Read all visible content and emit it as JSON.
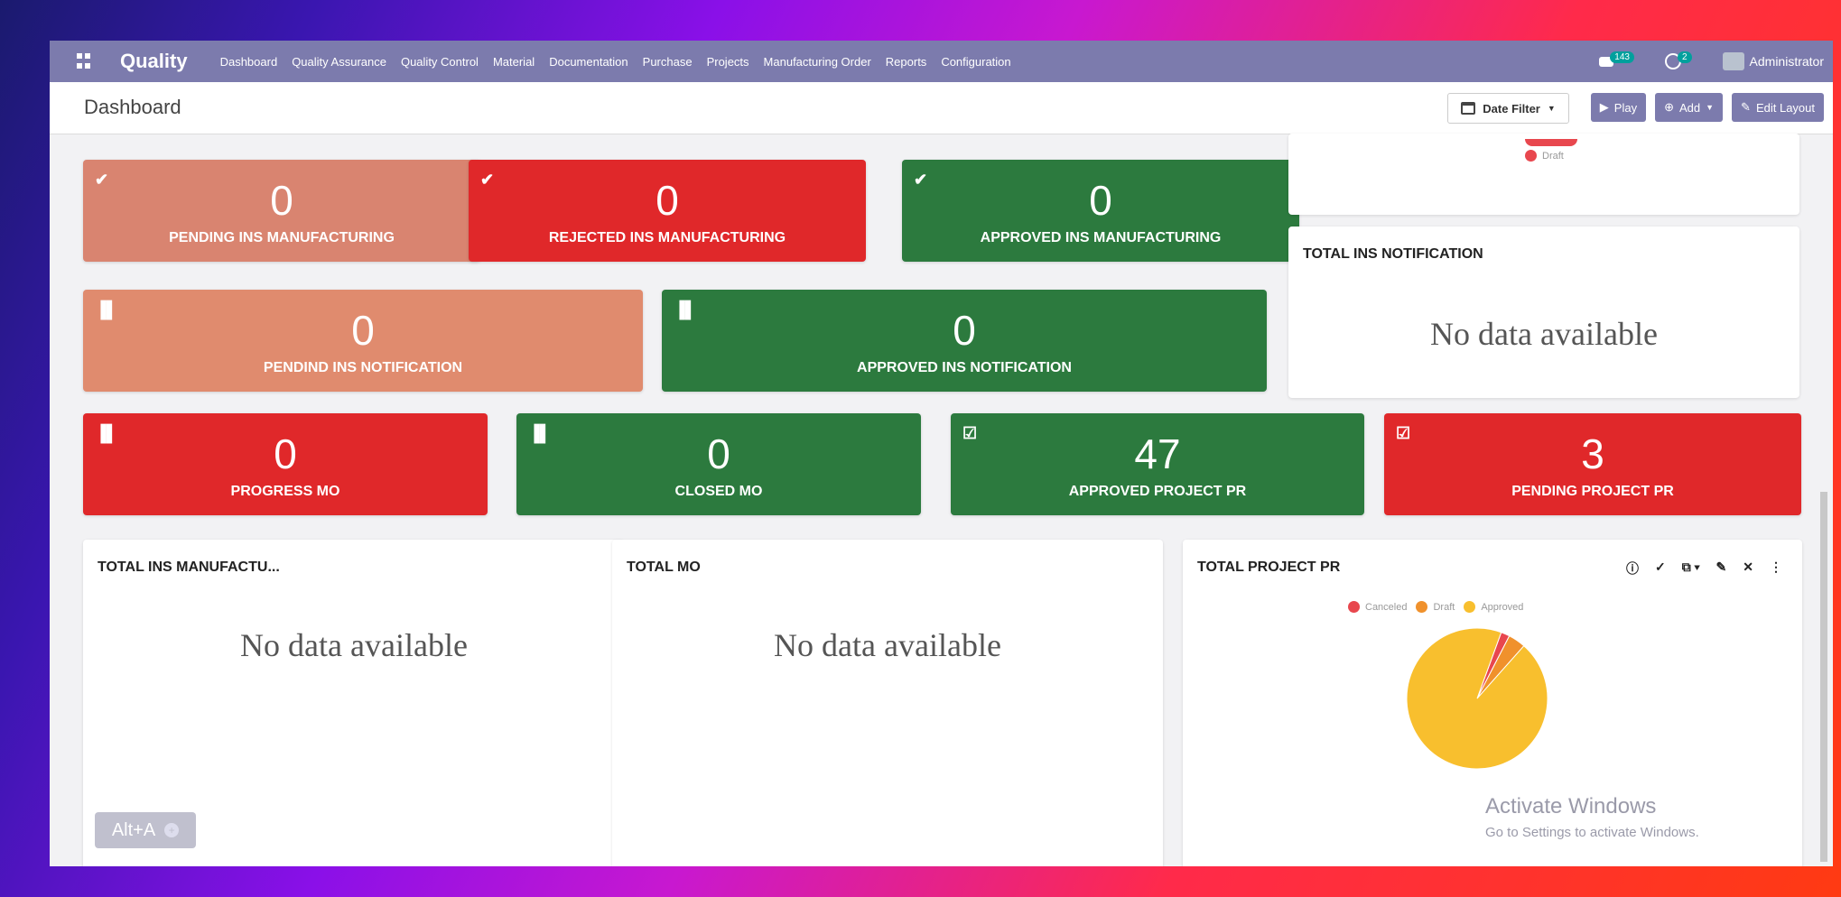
{
  "navbar": {
    "brand": "Quality",
    "menu": [
      "Dashboard",
      "Quality Assurance",
      "Quality Control",
      "Material",
      "Documentation",
      "Purchase",
      "Projects",
      "Manufacturing Order",
      "Reports",
      "Configuration"
    ],
    "chat_count": "143",
    "activity_count": "2",
    "user": "Administrator"
  },
  "control_panel": {
    "title": "Dashboard",
    "date_filter": "Date Filter",
    "play": "Play",
    "add": "Add",
    "edit_layout": "Edit Layout"
  },
  "tiles": [
    {
      "id": "pending-ins-manufacturing",
      "value": "0",
      "label": "PENDING INS MANUFACTURING",
      "icon": "check-icon",
      "color": "#d98470"
    },
    {
      "id": "rejected-ins-manufacturing",
      "value": "0",
      "label": "REJECTED INS MANUFACTURING",
      "icon": "check-icon",
      "color": "#e0282a"
    },
    {
      "id": "approved-ins-manufacturing",
      "value": "0",
      "label": "APPROVED INS MANUFACTURING",
      "icon": "check-icon",
      "color": "#2c7a3e"
    },
    {
      "id": "pendind-ins-notification",
      "value": "0",
      "label": "PENDIND INS NOTIFICATION",
      "icon": "bar-chart-icon",
      "color": "#e08b6e"
    },
    {
      "id": "approved-ins-notification",
      "value": "0",
      "label": "APPROVED INS NOTIFICATION",
      "icon": "bar-chart-icon",
      "color": "#2c7a3e"
    },
    {
      "id": "progress-mo",
      "value": "0",
      "label": "PROGRESS MO",
      "icon": "bar-chart-icon",
      "color": "#e0282a"
    },
    {
      "id": "closed-mo",
      "value": "0",
      "label": "CLOSED MO",
      "icon": "bar-chart-icon",
      "color": "#2c7a3e"
    },
    {
      "id": "approved-project-pr",
      "value": "47",
      "label": "APPROVED PROJECT PR",
      "icon": "checkbox-icon",
      "color": "#2c7a3e"
    },
    {
      "id": "pending-project-pr",
      "value": "3",
      "label": "PENDING PROJECT PR",
      "icon": "checkbox-icon",
      "color": "#e0282a"
    }
  ],
  "cards": {
    "top_partial": {
      "legend": "Draft"
    },
    "total_ins_notification": {
      "title": "TOTAL INS NOTIFICATION",
      "empty": "No data available"
    },
    "total_ins_manufactu": {
      "title": "TOTAL INS MANUFACTU...",
      "empty": "No data available"
    },
    "total_mo": {
      "title": "TOTAL MO",
      "empty": "No data available"
    },
    "total_project_pr": {
      "title": "TOTAL PROJECT PR"
    }
  },
  "chart_data": {
    "type": "pie",
    "categories": [
      "Canceled",
      "Draft",
      "Approved"
    ],
    "colors": [
      "#e8474e",
      "#f0912c",
      "#f8bf2e"
    ],
    "values": [
      1,
      2,
      47
    ]
  },
  "shortcut": "Alt+A",
  "watermark": {
    "title": "Activate Windows",
    "subtitle": "Go to Settings to activate Windows."
  }
}
